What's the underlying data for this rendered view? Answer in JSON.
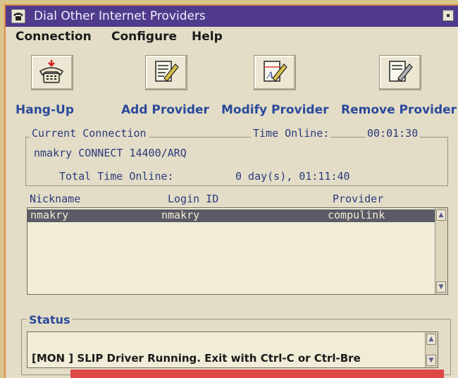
{
  "window": {
    "title": "Dial Other Internet Providers"
  },
  "menu": [
    {
      "label": "Connection"
    },
    {
      "label": "Configure"
    },
    {
      "label": "Help"
    }
  ],
  "toolbar": [
    {
      "label": "Hang-Up",
      "icon": "telephone-icon"
    },
    {
      "label": "Add Provider",
      "icon": "notepad-pencil-icon"
    },
    {
      "label": "Modify Provider",
      "icon": "notepad-edit-icon"
    },
    {
      "label": "Remove Provider",
      "icon": "notepad-eraser-icon"
    }
  ],
  "current_connection": {
    "group_label": "Current Connection",
    "time_online_label": "Time Online:",
    "time_online_value": "00:01:30",
    "connection_info": "nmakry CONNECT 14400/ARQ",
    "total_time_label": "Total Time Online:",
    "total_time_value": "0 day(s), 01:11:40"
  },
  "provider_list": {
    "columns": [
      "Nickname",
      "Login ID",
      "Provider"
    ],
    "rows": [
      {
        "nickname": "nmakry",
        "login_id": "nmakry",
        "provider": "compulink"
      }
    ]
  },
  "status": {
    "group_label": "Status",
    "text": "[MON ] SLIP Driver Running. Exit with Ctrl-C or Ctrl-Bre"
  },
  "colors": {
    "titlebar": "#4f3a8c",
    "selection": "#5b5a66",
    "link_text": "#2b4a9a",
    "accent_bar": "#e04848"
  }
}
